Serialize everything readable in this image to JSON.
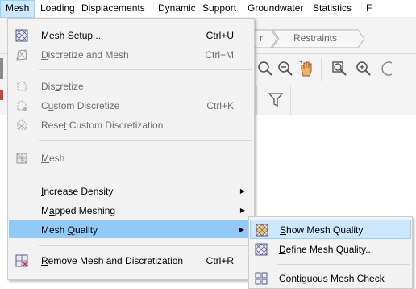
{
  "menubar": {
    "items": [
      {
        "label": "Mesh"
      },
      {
        "label": "Loading"
      },
      {
        "label": "Displacements"
      },
      {
        "label": "Dynamic"
      },
      {
        "label": "Support"
      },
      {
        "label": "Groundwater"
      },
      {
        "label": "Statistics"
      },
      {
        "label": "F"
      }
    ]
  },
  "background": {
    "breadcrumb_partial": "r",
    "breadcrumb_next": "Restraints"
  },
  "menu": {
    "items": [
      {
        "label_pre": "Mesh ",
        "label_u": "S",
        "label_post": "etup...",
        "shortcut": "Ctrl+U"
      },
      {
        "label_pre": "",
        "label_u": "D",
        "label_post": "iscretize and Mesh",
        "shortcut": "Ctrl+M"
      },
      {
        "label_pre": "Dis",
        "label_u": "c",
        "label_post": "retize",
        "shortcut": ""
      },
      {
        "label_pre": "C",
        "label_u": "u",
        "label_post": "stom Discretize",
        "shortcut": "Ctrl+K"
      },
      {
        "label_pre": "Rese",
        "label_u": "t",
        "label_post": " Custom Discretization",
        "shortcut": ""
      },
      {
        "label_pre": "",
        "label_u": "M",
        "label_post": "esh",
        "shortcut": ""
      },
      {
        "label_pre": "",
        "label_u": "I",
        "label_post": "ncrease Density",
        "shortcut": ""
      },
      {
        "label_pre": "M",
        "label_u": "a",
        "label_post": "pped Meshing",
        "shortcut": ""
      },
      {
        "label_pre": "Mesh ",
        "label_u": "Q",
        "label_post": "uality",
        "shortcut": ""
      },
      {
        "label_pre": "",
        "label_u": "R",
        "label_post": "emove Mesh and Discretization",
        "shortcut": "Ctrl+R"
      }
    ]
  },
  "submenu": {
    "items": [
      {
        "label_pre": "",
        "label_u": "S",
        "label_post": "how Mesh Quality"
      },
      {
        "label_pre": "",
        "label_u": "D",
        "label_post": "efine Mesh Quality..."
      },
      {
        "label_pre": "Contiguous Mesh Check",
        "label_u": "",
        "label_post": ""
      }
    ]
  },
  "colors": {
    "highlight": "#91c9f7",
    "hover": "#cce8ff",
    "menu_bg": "#f2f2f2"
  }
}
